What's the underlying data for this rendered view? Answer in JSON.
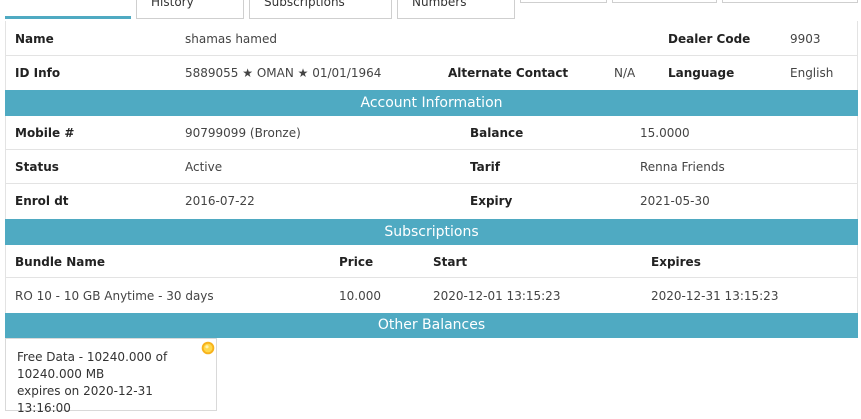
{
  "tabs": [
    {
      "label": ""
    },
    {
      "label": "History"
    },
    {
      "label": "Subscriptions"
    },
    {
      "label": "Numbers"
    },
    {
      "label": ""
    },
    {
      "label": ""
    },
    {
      "label": ""
    }
  ],
  "customer": {
    "name_label": "Name",
    "name_value": "shamas hamed",
    "dealer_label": "Dealer Code",
    "dealer_value": "9903",
    "id_label": "ID Info",
    "id_value": "5889055 ★ OMAN ★ 01/01/1964",
    "alt_label": "Alternate Contact",
    "alt_value": "N/A",
    "lang_label": "Language",
    "lang_value": "English"
  },
  "account": {
    "title": "Account Information",
    "mobile_label": "Mobile #",
    "mobile_value": "90799099 (Bronze)",
    "balance_label": "Balance",
    "balance_value": "15.0000",
    "status_label": "Status",
    "status_value": "Active",
    "tarif_label": "Tarif",
    "tarif_value": "Renna Friends",
    "enrol_label": "Enrol dt",
    "enrol_value": "2016-07-22",
    "expiry_label": "Expiry",
    "expiry_value": "2021-05-30"
  },
  "subscriptions": {
    "title": "Subscriptions",
    "headers": [
      "Bundle Name",
      "Price",
      "Start",
      "Expires"
    ],
    "rows": [
      {
        "bundle": "RO 10 - 10 GB Anytime - 30 days",
        "price": "10.000",
        "start": "2020-12-01 13:15:23",
        "expires": "2020-12-31 13:15:23"
      }
    ]
  },
  "other_balances": {
    "title": "Other Balances",
    "card": {
      "line1": "Free Data - 10240.000 of",
      "line2": "10240.000 MB",
      "line3": "expires on 2020-12-31 13:16:00"
    },
    "icon": "sun-icon",
    "accent": "#4faac2"
  }
}
